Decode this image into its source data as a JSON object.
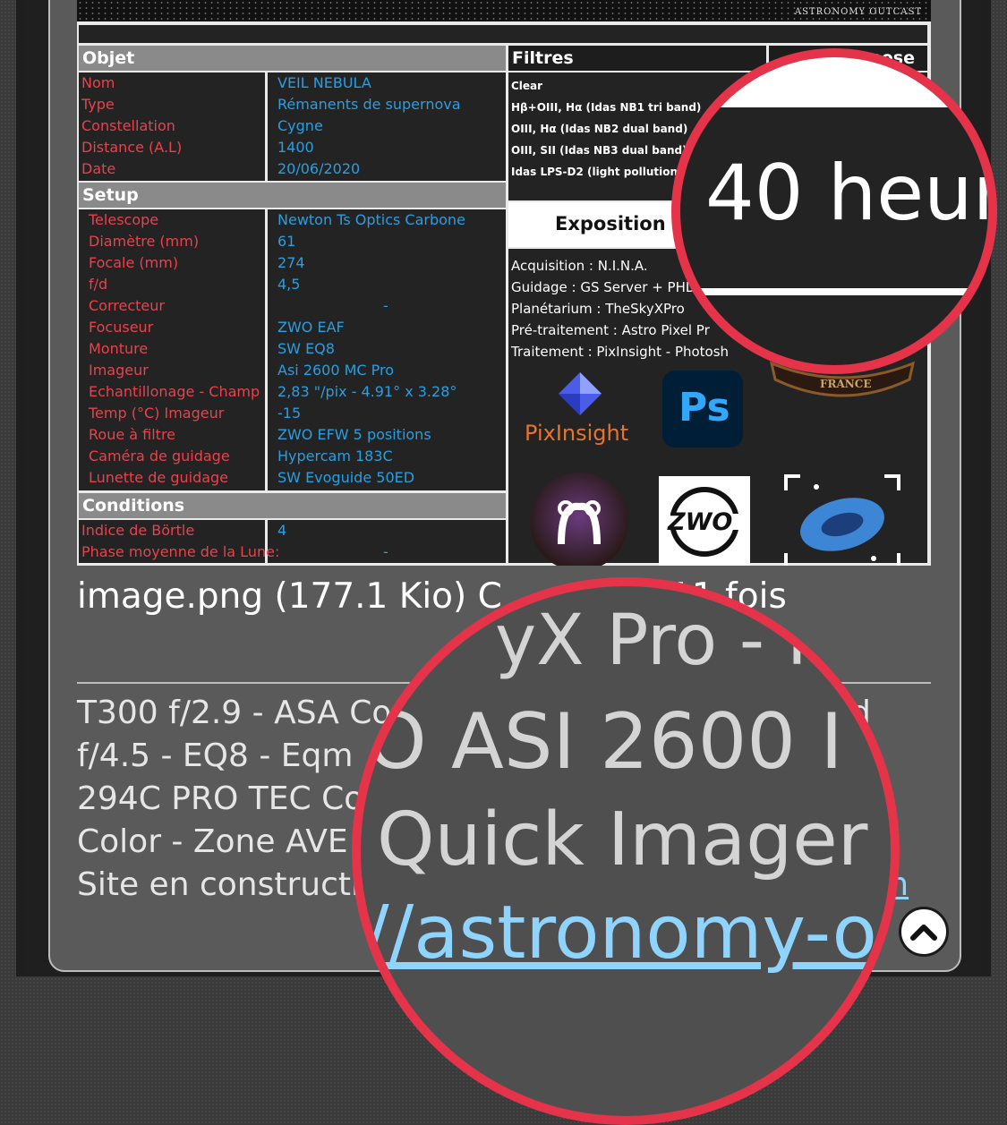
{
  "banner": {
    "credit": "ASTRONOMY OUTCAST"
  },
  "objet": {
    "header": "Objet",
    "rows": [
      {
        "label": "Nom",
        "value": "VEIL NEBULA"
      },
      {
        "label": "Type",
        "value": "Rémanents de supernova"
      },
      {
        "label": "Constellation",
        "value": "Cygne"
      },
      {
        "label": "Distance (A.L)",
        "value": "1400"
      },
      {
        "label": "Date",
        "value": "20/06/2020"
      }
    ]
  },
  "setup": {
    "header": "Setup",
    "rows": [
      {
        "label": "Telescope",
        "value": "Newton Ts Optics Carbone"
      },
      {
        "label": "Diamètre (mm)",
        "value": "61"
      },
      {
        "label": "Focale (mm)",
        "value": "274"
      },
      {
        "label": "f/d",
        "value": "4,5"
      },
      {
        "label": "Correcteur",
        "value": "-"
      },
      {
        "label": "Focuseur",
        "value": "ZWO EAF"
      },
      {
        "label": "Monture",
        "value": "SW EQ8"
      },
      {
        "label": "Imageur",
        "value": "Asi 2600 MC Pro"
      },
      {
        "label": "Echantillonage - Champ",
        "value": "2,83 \"/pix - 4.91° x 3.28°"
      },
      {
        "label": "Temp (°C) Imageur",
        "value": "-15"
      },
      {
        "label": "Roue à filtre",
        "value": "ZWO EFW  5 positions"
      },
      {
        "label": "Caméra de guidage",
        "value": "Hypercam 183C"
      },
      {
        "label": "Lunette de guidage",
        "value": "SW Evoguide 50ED"
      }
    ]
  },
  "conditions": {
    "header": "Conditions",
    "rows": [
      {
        "label": "Indice de Börtle",
        "value": "4"
      },
      {
        "label": "Phase moyenne de la Lune:",
        "value": "-"
      }
    ]
  },
  "filtres": {
    "header": "Filtres",
    "col2_header": "pose",
    "items": [
      "Clear",
      "Hβ+OIII, Hα (Idas NB1 tri band)",
      "OIII, Hα (Idas NB2 dual band)",
      "OIII, SII (Idas NB3 dual band)",
      "Idas LPS-D2 (light pollution sup"
    ]
  },
  "exposition": {
    "title": "Exposition t",
    "magnified": "40 heur"
  },
  "software": [
    "Acquisition : N.I.N.A.",
    "Guidage : GS Server + PHD",
    "Planétarium : TheSkyXPro",
    "Pré-traitement : Astro Pixel Pr",
    "Traitement : PixInsight - Photosh"
  ],
  "logos": {
    "pixinsight": "PixInsight",
    "photoshop": "Ps",
    "zwo": "ZWO",
    "france": "FRANCE"
  },
  "caption": "image.png (177.1 Kio) C",
  "caption_end": "11 fois",
  "signature": {
    "lines": [
      "T300 f/2.9 - ASA Co",
      "f/4.5 - EQ8 - Eqm",
      "294C PRO TEC Co",
      "Color - Zone AVE",
      "Site en constructi"
    ],
    "line1_end": "d",
    "line5_end": "m"
  },
  "magnified": {
    "line1": "yX Pro - F",
    "line2": "O ASI 2600 I",
    "line3": "Quick Imager",
    "line4": "//astronomy-o"
  },
  "colors": {
    "label": "#e8424c",
    "value": "#2a9ee0",
    "lens": "#e5334a",
    "link": "#8fd3ff"
  }
}
